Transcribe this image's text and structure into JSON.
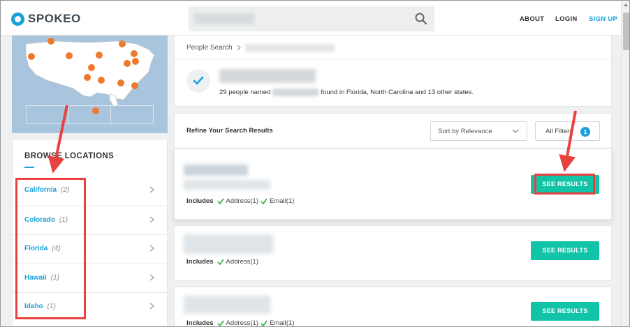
{
  "header": {
    "logo_text": "SPOKEO",
    "nav": {
      "about": "ABOUT",
      "login": "LOGIN",
      "signup": "SIGN UP"
    }
  },
  "breadcrumb": {
    "root": "People Search"
  },
  "summary": {
    "found_prefix": "29 people named",
    "found_suffix": "found in Florida, North Carolina and 13 other states."
  },
  "browse": {
    "title": "BROWSE LOCATIONS",
    "locations": [
      {
        "name": "California",
        "count": "(2)"
      },
      {
        "name": "Colorado",
        "count": "(1)"
      },
      {
        "name": "Florida",
        "count": "(4)"
      },
      {
        "name": "Hawaii",
        "count": "(1)"
      },
      {
        "name": "Idaho",
        "count": "(1)"
      }
    ]
  },
  "refine": {
    "title": "Refine Your Search Results",
    "sort_label": "Sort by Relevance",
    "filters_label": "All Filters",
    "filters_count": "1"
  },
  "results": [
    {
      "includes_label": "Includes",
      "items": [
        "Address(1)",
        "Email(1)"
      ],
      "button": "SEE RESULTS"
    },
    {
      "includes_label": "Includes",
      "items": [
        "Address(1)"
      ],
      "button": "SEE RESULTS"
    },
    {
      "includes_label": "Includes",
      "items": [
        "Address(1)",
        "Email(1)"
      ],
      "button": "SEE RESULTS"
    }
  ],
  "colors": {
    "brand_blue": "#1aa0d8",
    "button_teal": "#12c4a7",
    "annotation_red": "#e8423f",
    "map_pin": "#ee7a2f"
  }
}
